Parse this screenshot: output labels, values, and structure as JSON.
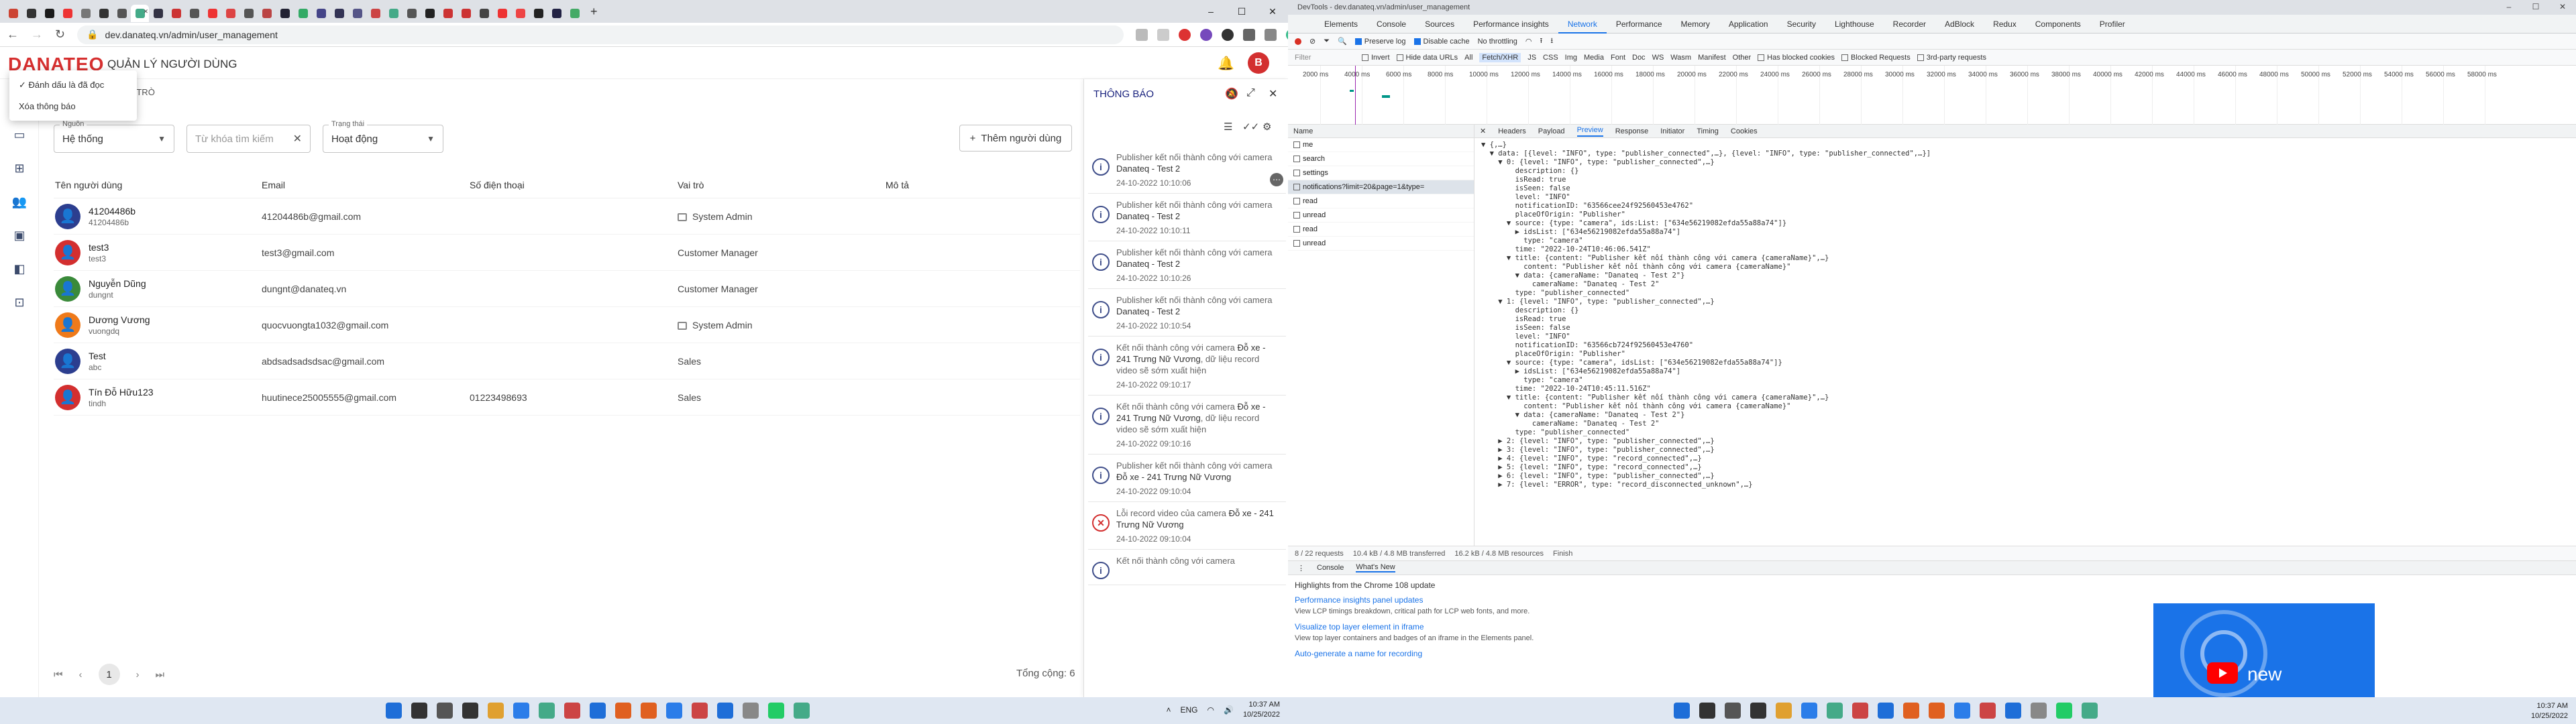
{
  "browser": {
    "tab_favicon_colors": [
      "#c43",
      "#333",
      "#1a1a1a",
      "#e33",
      "#777",
      "#333",
      "#555",
      "#4a8",
      "#334",
      "#c33",
      "#555",
      "#e33",
      "#d44",
      "#555",
      "#b44",
      "#223",
      "#3a6",
      "#448",
      "#335",
      "#558",
      "#c44",
      "#4a8",
      "#555",
      "#222",
      "#c33",
      "#c33",
      "#444",
      "#e33",
      "#e44",
      "#222",
      "#224",
      "#4a6"
    ],
    "active_tab_index": 7,
    "url": "dev.danateq.vn/admin/user_management"
  },
  "app": {
    "logo": "DANATEQ",
    "page_heading": "QUẢN LÝ NGƯỜI DÙNG",
    "avatar_letter": "B",
    "popup_menu": [
      "Đánh dấu là đã đọc",
      "Xóa thông báo"
    ],
    "role_tabs": [
      "VAI TRÒ"
    ],
    "filters": {
      "source_label": "Nguồn",
      "source_value": "Hệ thống",
      "search_placeholder": "Từ khóa tìm kiếm",
      "status_label": "Trạng thái",
      "status_value": "Hoạt động"
    },
    "add_user_label": "Thêm người dùng",
    "table": {
      "headers": [
        "Tên người dùng",
        "Email",
        "Số điện thoại",
        "Vai trò",
        "Mô tả"
      ],
      "rows": [
        {
          "name": "41204486b",
          "login": "41204486b",
          "email": "41204486b@gmail.com",
          "phone": "",
          "role": "System Admin",
          "avatar_color": "#2c3e8f",
          "role_icon": true
        },
        {
          "name": "test3",
          "login": "test3",
          "email": "test3@gmail.com",
          "phone": "",
          "role": "Customer Manager",
          "avatar_color": "#d32f2f",
          "role_icon": false
        },
        {
          "name": "Nguyễn Dũng",
          "login": "dungnt",
          "email": "dungnt@danateq.vn",
          "phone": "",
          "role": "Customer Manager",
          "avatar_color": "#3a8a3a",
          "role_icon": false
        },
        {
          "name": "Dương Vương",
          "login": "vuongdq",
          "email": "quocvuongta1032@gmail.com",
          "phone": "",
          "role": "System Admin",
          "avatar_color": "#ef7a1a",
          "role_icon": true
        },
        {
          "name": "Test",
          "login": "abc",
          "email": "abdsadsadsdsac@gmail.com",
          "phone": "",
          "role": "Sales",
          "avatar_color": "#2c3e8f",
          "role_icon": false
        },
        {
          "name": "Tín Đỗ Hữu123",
          "login": "tindh",
          "email": "huutinece25005555@gmail.com",
          "phone": "01223498693",
          "role": "Sales",
          "avatar_color": "#d32f2f",
          "role_icon": false
        }
      ]
    },
    "pager": {
      "current": "1"
    },
    "total_label": "Tổng cộng: 6",
    "notifications": {
      "title": "THÔNG BÁO",
      "items": [
        {
          "text": "Publisher kết nối thành công với camera ",
          "bold": "Danateq - Test 2",
          "time": "24-10-2022 10:10:06",
          "type": "info",
          "more": true
        },
        {
          "text": "Publisher kết nối thành công với camera ",
          "bold": "Danateq - Test 2",
          "time": "24-10-2022 10:10:11",
          "type": "info",
          "more": false
        },
        {
          "text": "Publisher kết nối thành công với camera ",
          "bold": "Danateq - Test 2",
          "time": "24-10-2022 10:10:26",
          "type": "info",
          "more": false
        },
        {
          "text": "Publisher kết nối thành công với camera ",
          "bold": "Danateq - Test 2",
          "time": "24-10-2022 10:10:54",
          "type": "info",
          "more": false
        },
        {
          "text": "Kết nối thành công với camera ",
          "bold": "Đỗ xe - 241 Trưng Nữ Vương",
          "tail": ", dữ liệu record video sẽ sớm xuất hiện",
          "time": "24-10-2022 09:10:17",
          "type": "info",
          "more": false
        },
        {
          "text": "Kết nối thành công với camera ",
          "bold": "Đỗ xe - 241 Trưng Nữ Vương",
          "tail": ", dữ liệu record video sẽ sớm xuất hiện",
          "time": "24-10-2022 09:10:16",
          "type": "info",
          "more": false
        },
        {
          "text": "Publisher kết nối thành công với camera ",
          "bold": "Đỗ xe - 241 Trưng Nữ Vương",
          "time": "24-10-2022 09:10:04",
          "type": "info",
          "more": false
        },
        {
          "text": "Lỗi record video của camera ",
          "bold": "Đỗ xe - 241 Trưng Nữ Vương",
          "time": "24-10-2022 09:10:04",
          "type": "error",
          "more": false
        },
        {
          "text": "Kết nối thành công với camera",
          "bold": "",
          "time": "",
          "type": "info",
          "more": false
        }
      ]
    }
  },
  "taskbar_left": {
    "icon_colors": [
      "#1e6ed8",
      "#333",
      "#555",
      "#333",
      "#e0a030",
      "#2b7de9",
      "#4a8",
      "#c44",
      "#1e6ed8",
      "#e06020",
      "#e06020",
      "#2b7de9",
      "#c44",
      "#1e6ed8",
      "#888",
      "#2c6",
      "#4a8"
    ],
    "lang": "ENG",
    "time": "10:37 AM",
    "date": "10/25/2022"
  },
  "devtools": {
    "title": "DevTools - dev.danateq.vn/admin/user_management",
    "panels": [
      "Elements",
      "Console",
      "Sources",
      "Performance insights",
      "Network",
      "Performance",
      "Memory",
      "Application",
      "Security",
      "Lighthouse",
      "Recorder",
      "AdBlock",
      "Redux",
      "Components",
      "Profiler"
    ],
    "active_panel": "Network",
    "toolbar": {
      "preserve_log": "Preserve log",
      "disable_cache": "Disable cache",
      "throttling": "No throttling"
    },
    "filter_placeholder": "Filter",
    "filter_options": [
      "Invert",
      "Hide data URLs",
      "All",
      "Fetch/XHR",
      "JS",
      "CSS",
      "Img",
      "Media",
      "Font",
      "Doc",
      "WS",
      "Wasm",
      "Manifest",
      "Other",
      "Has blocked cookies",
      "Blocked Requests",
      "3rd-party requests"
    ],
    "timeline_ticks": [
      "2000 ms",
      "4000 ms",
      "6000 ms",
      "8000 ms",
      "10000 ms",
      "12000 ms",
      "14000 ms",
      "16000 ms",
      "18000 ms",
      "20000 ms",
      "22000 ms",
      "24000 ms",
      "26000 ms",
      "28000 ms",
      "30000 ms",
      "32000 ms",
      "34000 ms",
      "36000 ms",
      "38000 ms",
      "40000 ms",
      "42000 ms",
      "44000 ms",
      "46000 ms",
      "48000 ms",
      "50000 ms",
      "52000 ms",
      "54000 ms",
      "56000 ms",
      "58000 ms"
    ],
    "name_header": "Name",
    "requests": [
      "me",
      "search",
      "settings",
      "notifications?limit=20&page=1&type=",
      "read",
      "unread",
      "read",
      "unread"
    ],
    "selected_request": 3,
    "detail_tabs": [
      "Headers",
      "Payload",
      "Preview",
      "Response",
      "Initiator",
      "Timing",
      "Cookies"
    ],
    "active_detail_tab": "Preview",
    "preview_lines": [
      "▼ {,…}",
      "  ▼ data: [{level: \"INFO\", type: \"publisher_connected\",…}, {level: \"INFO\", type: \"publisher_connected\",…}]",
      "    ▼ 0: {level: \"INFO\", type: \"publisher_connected\",…}",
      "        description: {}",
      "        isRead: true",
      "        isSeen: false",
      "        level: \"INFO\"",
      "        notificationID: \"63566cee24f92560453e4762\"",
      "        placeOfOrigin: \"Publisher\"",
      "      ▼ source: {type: \"camera\", ids:List: [\"634e56219082efda55a88a74\"]}",
      "        ▶ idsList: [\"634e56219082efda55a88a74\"]",
      "          type: \"camera\"",
      "        time: \"2022-10-24T10:46:06.541Z\"",
      "      ▼ title: {content: \"Publisher kết nối thành công với camera {cameraName}\",…}",
      "          content: \"Publisher kết nối thành công với camera {cameraName}\"",
      "        ▼ data: {cameraName: \"Danateq - Test 2\"}",
      "            cameraName: \"Danateq - Test 2\"",
      "        type: \"publisher_connected\"",
      "    ▼ 1: {level: \"INFO\", type: \"publisher_connected\",…}",
      "        description: {}",
      "        isRead: true",
      "        isSeen: false",
      "        level: \"INFO\"",
      "        notificationID: \"63566cb724f92560453e4760\"",
      "        placeOfOrigin: \"Publisher\"",
      "      ▼ source: {type: \"camera\", idsList: [\"634e56219082efda55a88a74\"]}",
      "        ▶ idsList: [\"634e56219082efda55a88a74\"]",
      "          type: \"camera\"",
      "        time: \"2022-10-24T10:45:11.516Z\"",
      "      ▼ title: {content: \"Publisher kết nối thành công với camera {cameraName}\",…}",
      "          content: \"Publisher kết nối thành công với camera {cameraName}\"",
      "        ▼ data: {cameraName: \"Danateq - Test 2\"}",
      "            cameraName: \"Danateq - Test 2\"",
      "        type: \"publisher_connected\"",
      "    ▶ 2: {level: \"INFO\", type: \"publisher_connected\",…}",
      "    ▶ 3: {level: \"INFO\", type: \"publisher_connected\",…}",
      "    ▶ 4: {level: \"INFO\", type: \"record_connected\",…}",
      "    ▶ 5: {level: \"INFO\", type: \"record_connected\",…}",
      "    ▶ 6: {level: \"INFO\", type: \"publisher_connected\",…}",
      "    ▶ 7: {level: \"ERROR\", type: \"record_disconnected_unknown\",…}"
    ],
    "status_bar": [
      "8 / 22 requests",
      "10.4 kB / 4.8 MB transferred",
      "16.2 kB / 4.8 MB resources",
      "Finish"
    ],
    "drawer_tabs": [
      "Console",
      "What's New"
    ],
    "whats_new_heading": "Highlights from the Chrome 108 update",
    "whats_new": [
      {
        "title": "Performance insights panel updates",
        "desc": "View LCP timings breakdown, critical path for LCP web fonts, and more."
      },
      {
        "title": "Visualize top layer element in iframe",
        "desc": "View top layer containers and badges of an iframe in the Elements panel."
      },
      {
        "title": "Auto-generate a name for recording",
        "desc": ""
      }
    ],
    "video_label": "new"
  },
  "taskbar_right": {
    "time": "10:37 AM",
    "date": "10/25/2022"
  }
}
